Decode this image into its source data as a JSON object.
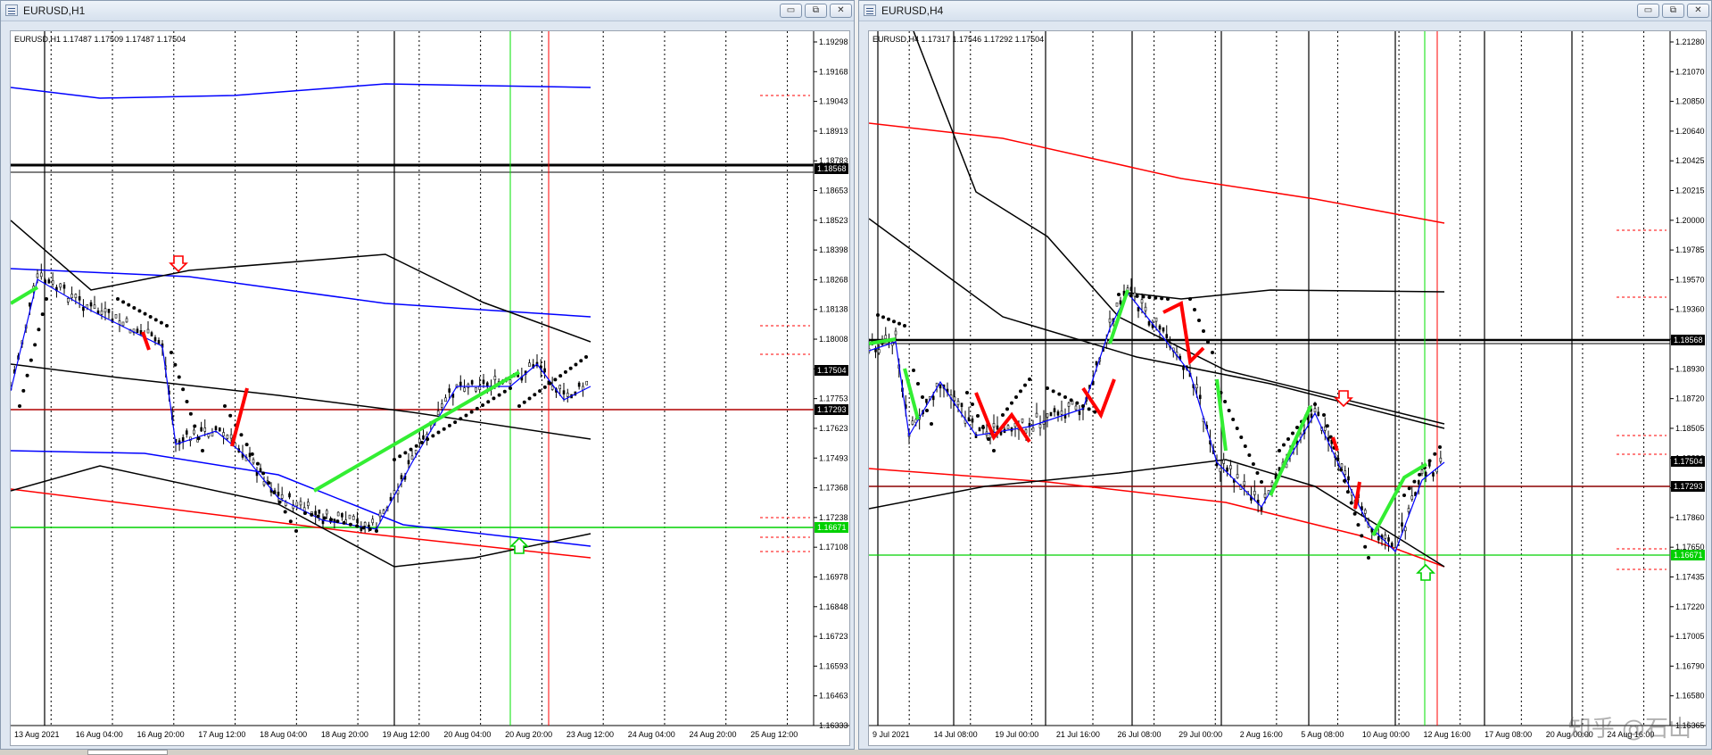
{
  "left": {
    "title": "EURUSD,H1",
    "info": "EURUSD,H1  1.17487 1.17509 1.17487 1.17504",
    "prices": [
      "1.19298",
      "1.19168",
      "1.19043",
      "1.18913",
      "1.18783",
      "1.18653",
      "1.18523",
      "1.18398",
      "1.18268",
      "1.18138",
      "1.18008",
      "1.17878",
      "1.17753",
      "1.17623",
      "1.17493",
      "1.17368",
      "1.17238",
      "1.17108",
      "1.16978",
      "1.16848",
      "1.16723",
      "1.16593",
      "1.16463",
      "1.16333"
    ],
    "marker_labels": [
      "1.18568",
      "1.17504",
      "1.17293",
      "1.16671"
    ],
    "dates": [
      "13 Aug 2021",
      "16 Aug 04:00",
      "16 Aug 20:00",
      "17 Aug 12:00",
      "18 Aug 04:00",
      "18 Aug 20:00",
      "19 Aug 12:00",
      "20 Aug 04:00",
      "20 Aug 20:00",
      "23 Aug 12:00",
      "24 Aug 04:00",
      "24 Aug 20:00",
      "25 Aug 12:00"
    ]
  },
  "right": {
    "title": "EURUSD,H4",
    "info": "EURUSD,H4  1.17317 1.17546 1.17292 1.17504",
    "prices": [
      "1.21280",
      "1.21070",
      "1.20850",
      "1.20640",
      "1.20425",
      "1.20215",
      "1.20000",
      "1.19785",
      "1.19570",
      "1.19360",
      "1.19145",
      "1.18930",
      "1.18720",
      "1.18505",
      "1.18290",
      "1.18075",
      "1.17860",
      "1.17650",
      "1.17435",
      "1.17220",
      "1.17005",
      "1.16790",
      "1.16580",
      "1.16365"
    ],
    "marker_labels": [
      "1.18568",
      "1.17504",
      "1.17293",
      "1.16671"
    ],
    "dates": [
      "9 Jul 2021",
      "14 Jul 08:00",
      "19 Jul 00:00",
      "21 Jul 16:00",
      "26 Jul 08:00",
      "29 Jul 00:00",
      "2 Aug 16:00",
      "5 Aug 08:00",
      "10 Aug 00:00",
      "12 Aug 16:00",
      "17 Aug 08:00",
      "20 Aug 00:00",
      "24 Aug 16:00"
    ]
  },
  "buttons": {
    "minimize": "▭",
    "restore": "⧉",
    "close": "✕"
  },
  "watermark": "知乎 @石山",
  "colors": {
    "red": "#ff0000",
    "green": "#00e000",
    "blue": "#0000ff",
    "black": "#000000",
    "dashred": "#ff0000"
  }
}
